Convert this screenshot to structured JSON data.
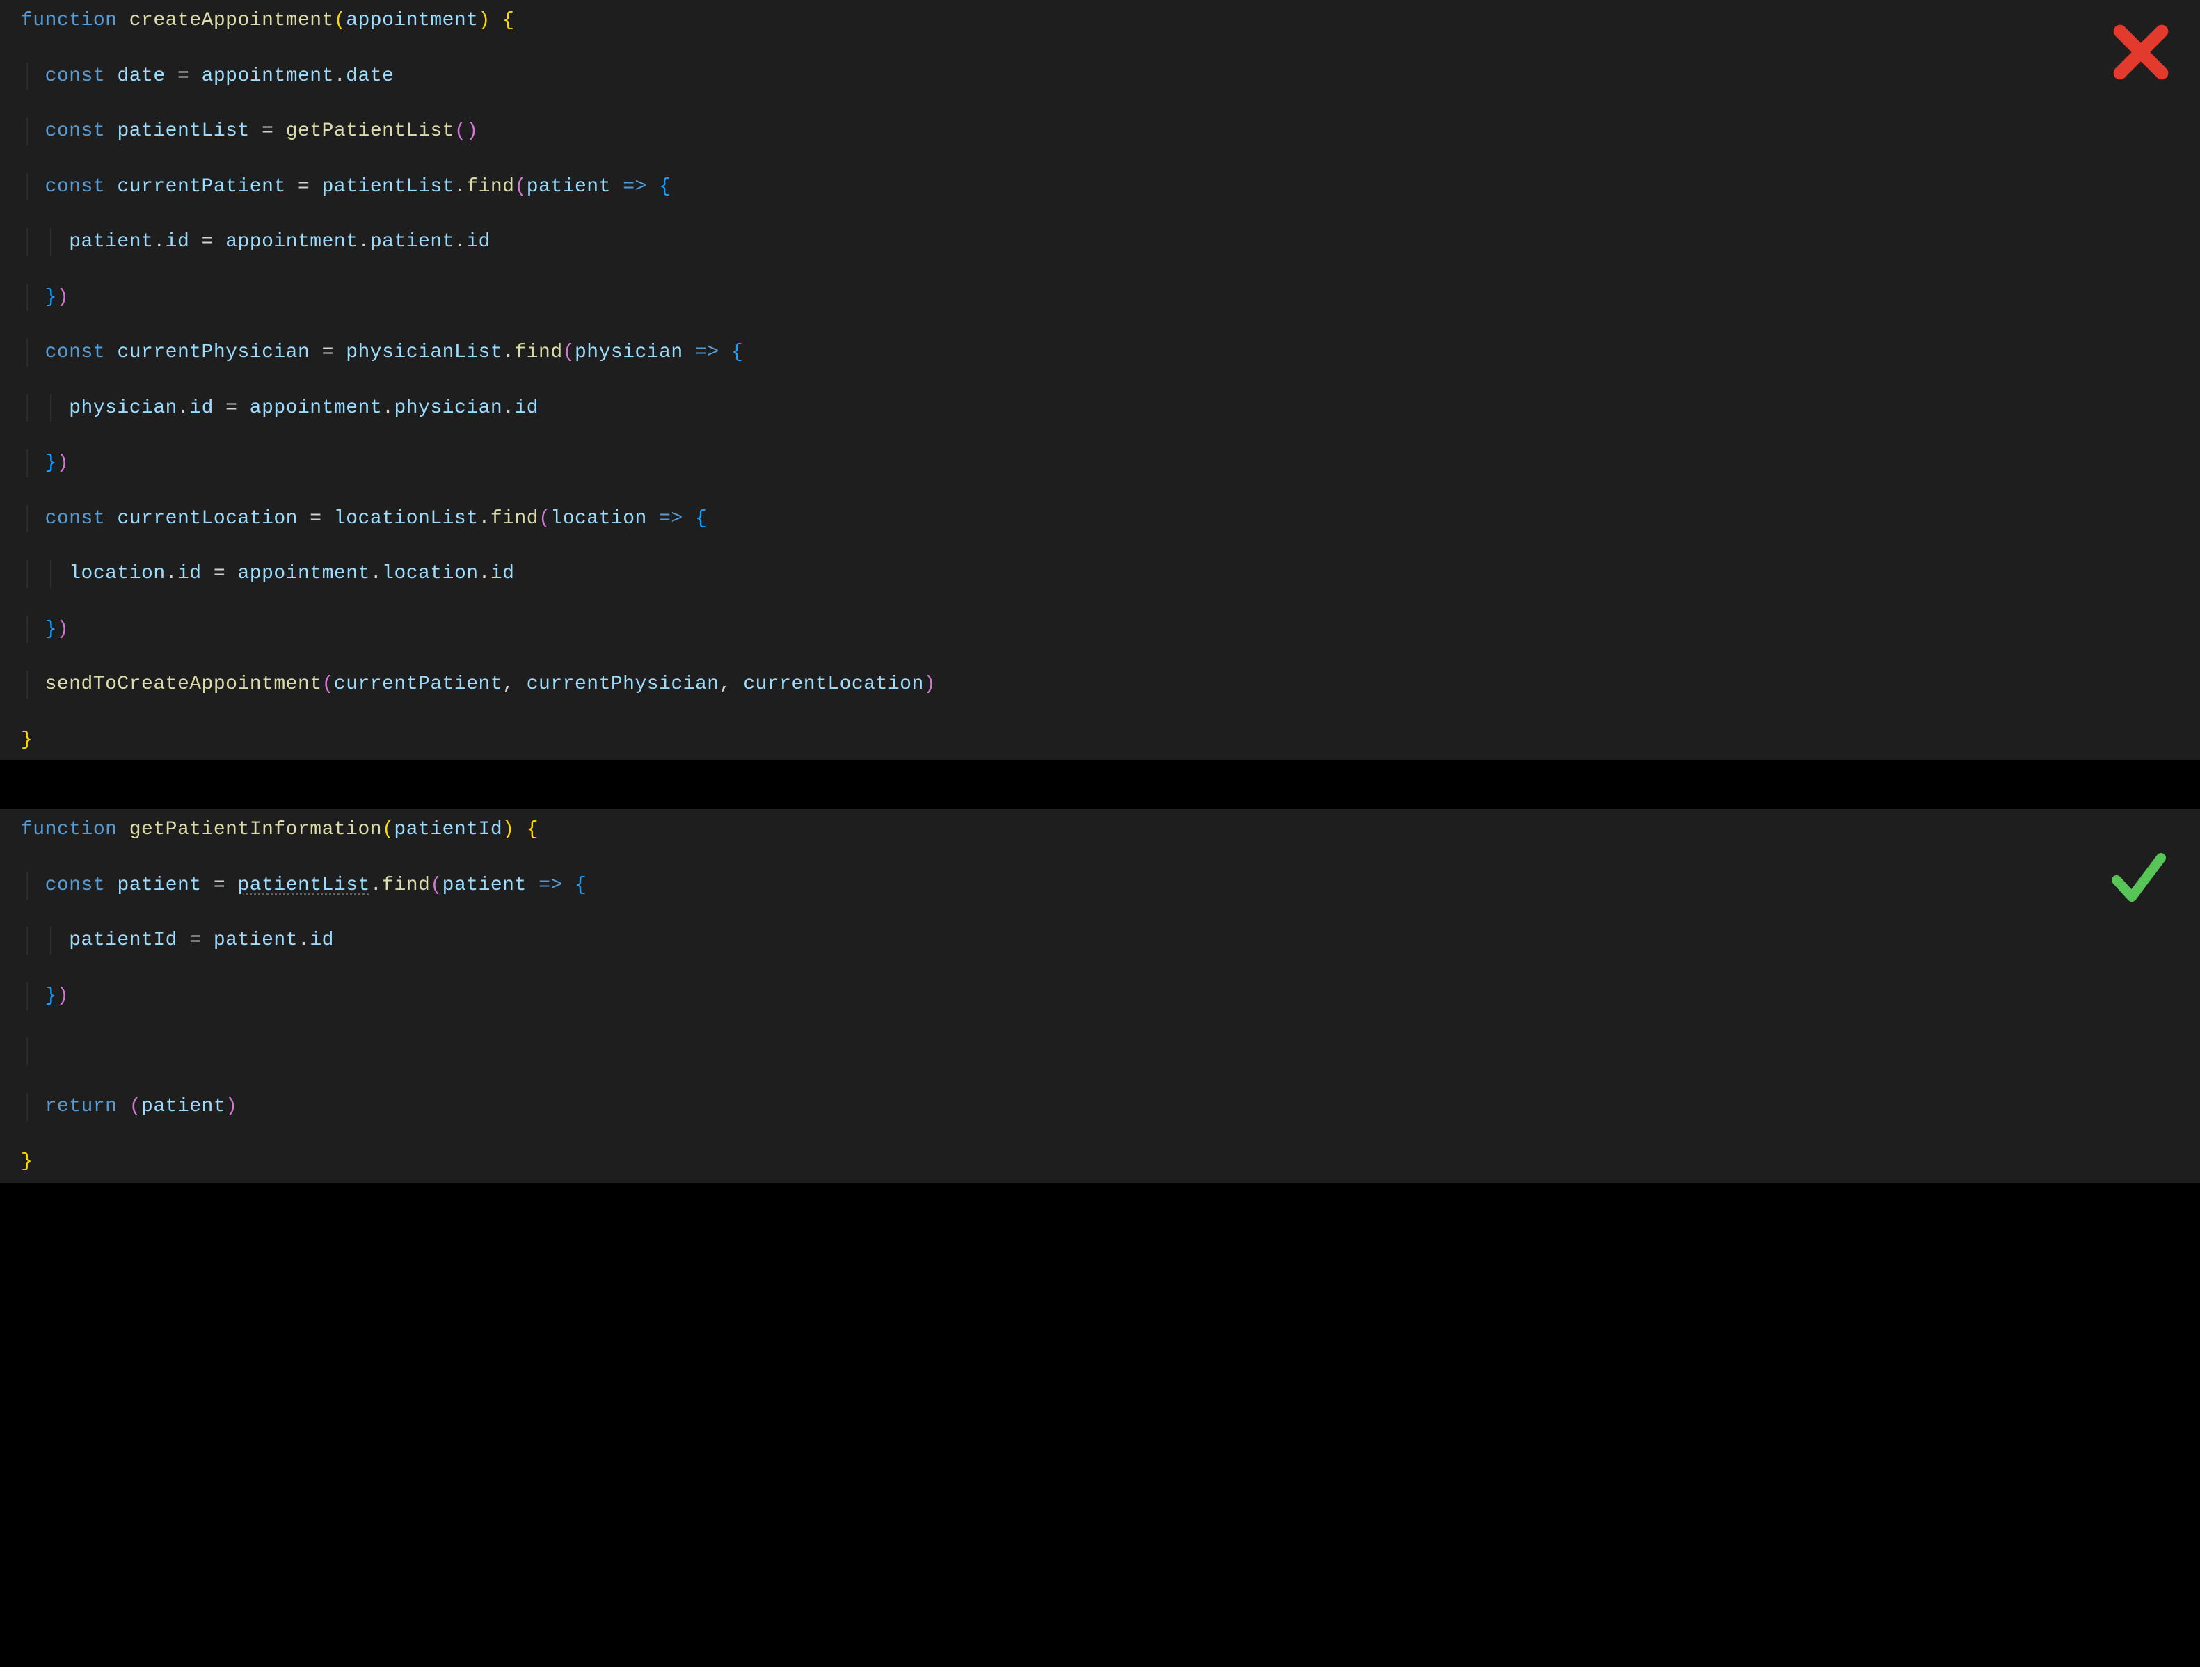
{
  "colors": {
    "bg": "#1e1e1e",
    "keyword": "#569cd6",
    "function": "#dcdcaa",
    "identifier": "#9cdcfe",
    "text": "#d4d4d4",
    "paren1": "#ffd700",
    "paren2": "#d278d2",
    "paren3": "#179fff",
    "cross": "#e23b2e",
    "check": "#58c558"
  },
  "snippet1": {
    "status": "bad",
    "l1": {
      "kw": "function ",
      "fn": "createAppointment",
      "p1o": "(",
      "arg": "appointment",
      "p1c": ")",
      "sp": " ",
      "brace": "{"
    },
    "l2": {
      "indent": "  ",
      "kw": "const ",
      "v": "date",
      "eq": " = ",
      "obj": "appointment",
      "dot": ".",
      "prop": "date"
    },
    "l3": {
      "indent": "  ",
      "kw": "const ",
      "v": "patientList",
      "eq": " = ",
      "fn": "getPatientList",
      "p": "()"
    },
    "l4": {
      "indent": "  ",
      "kw": "const ",
      "v": "currentPatient",
      "eq": " = ",
      "obj": "patientList",
      "dot": ".",
      "fn": "find",
      "po": "(",
      "arg": "patient",
      "arrow": " => ",
      "bo": "{"
    },
    "l5": {
      "indent": "    ",
      "a": "patient",
      "d1": ".",
      "b": "id",
      "eq": " = ",
      "c": "appointment",
      "d2": ".",
      "d": "patient",
      "d3": ".",
      "e": "id"
    },
    "l6": {
      "indent": "  ",
      "bc": "}",
      "pc": ")"
    },
    "l7": {
      "indent": "  ",
      "kw": "const ",
      "v": "currentPhysician",
      "eq": " = ",
      "obj": "physicianList",
      "dot": ".",
      "fn": "find",
      "po": "(",
      "arg": "physician",
      "arrow": " => ",
      "bo": "{"
    },
    "l8": {
      "indent": "    ",
      "a": "physician",
      "d1": ".",
      "b": "id",
      "eq": " = ",
      "c": "appointment",
      "d2": ".",
      "d": "physician",
      "d3": ".",
      "e": "id"
    },
    "l9": {
      "indent": "  ",
      "bc": "}",
      "pc": ")"
    },
    "l10": {
      "indent": "  ",
      "kw": "const ",
      "v": "currentLocation",
      "eq": " = ",
      "obj": "locationList",
      "dot": ".",
      "fn": "find",
      "po": "(",
      "arg": "location",
      "arrow": " => ",
      "bo": "{"
    },
    "l11": {
      "indent": "    ",
      "a": "location",
      "d1": ".",
      "b": "id",
      "eq": " = ",
      "c": "appointment",
      "d2": ".",
      "d": "location",
      "d3": ".",
      "e": "id"
    },
    "l12": {
      "indent": "  ",
      "bc": "}",
      "pc": ")"
    },
    "l13": {
      "indent": "  ",
      "fn": "sendToCreateAppointment",
      "po": "(",
      "a1": "currentPatient",
      "c1": ", ",
      "a2": "currentPhysician",
      "c2": ", ",
      "a3": "currentLocation",
      "pc": ")"
    },
    "l14": {
      "brace": "}"
    }
  },
  "snippet2": {
    "status": "good",
    "l1": {
      "kw": "function ",
      "fn": "getPatientInformation",
      "p1o": "(",
      "arg": "patientId",
      "p1c": ")",
      "sp": " ",
      "brace": "{"
    },
    "l2": {
      "indent": "  ",
      "kw": "const ",
      "v": "patient",
      "eq": " = ",
      "obj": "patientList",
      "dot": ".",
      "fn": "find",
      "po": "(",
      "arg": "patient",
      "arrow": " => ",
      "bo": "{"
    },
    "l3": {
      "indent": "    ",
      "a": "patientId",
      "eq": " = ",
      "b": "patient",
      "dot": ".",
      "c": "id"
    },
    "l4": {
      "indent": "  ",
      "bc": "}",
      "pc": ")"
    },
    "blank": " ",
    "l6": {
      "indent": "  ",
      "kw": "return ",
      "po": "(",
      "v": "patient",
      "pc": ")"
    },
    "l7": {
      "brace": "}"
    }
  }
}
